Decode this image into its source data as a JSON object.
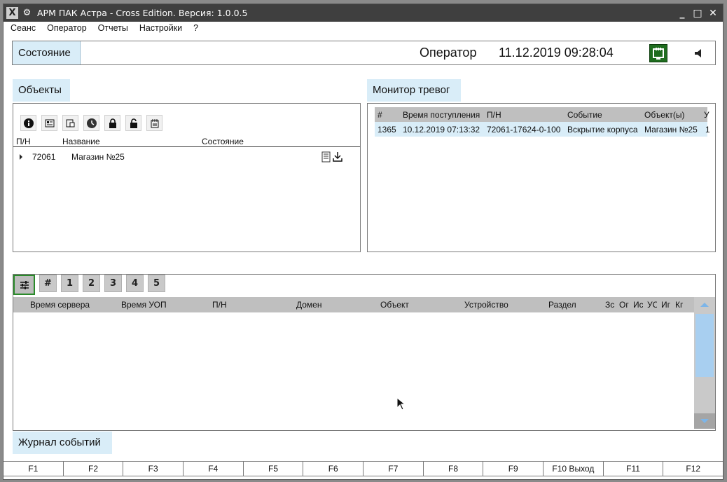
{
  "window": {
    "title": "АРМ ПАК Астра - Cross Edition. Версия: 1.0.0.5"
  },
  "menu": [
    "Сеанс",
    "Оператор",
    "Отчеты",
    "Настройки",
    "?"
  ],
  "status": {
    "label": "Состояние",
    "operator": "Оператор",
    "datetime": "11.12.2019 09:28:04",
    "network_icon": "network-connected-icon",
    "network_color": "#1f6d1f",
    "sound_icon": "speaker-icon"
  },
  "objects": {
    "tab_label": "Объекты",
    "toolbar_icons": [
      "info-icon",
      "card-icon",
      "folder-link-icon",
      "clock-icon",
      "lock-icon",
      "unlock-icon",
      "calendar-icon"
    ],
    "columns": [
      "П/Н",
      "Название",
      "Состояние"
    ],
    "rows": [
      {
        "pn": "72061",
        "name": "Магазин №25"
      }
    ]
  },
  "alarms": {
    "tab_label": "Монитор тревог",
    "columns": [
      "#",
      "Время поступления",
      "П/Н",
      "Событие",
      "Объект(ы)",
      "У"
    ],
    "rows": [
      {
        "num": "1365",
        "time": "10.12.2019 07:13:32",
        "pn": "72061-17624-0-100",
        "event": "Вскрытие корпуса",
        "object": "Магазин №25",
        "extra": "1"
      }
    ],
    "selected_color": "#d9edf8"
  },
  "journal": {
    "tab_label": "Журнал событий",
    "toolbar": [
      "filter-icon",
      "#",
      "1",
      "2",
      "3",
      "4",
      "5"
    ],
    "columns": [
      "Время сервера",
      "Время УОП",
      "П/Н",
      "Домен",
      "Объект",
      "Устройство",
      "Раздел",
      "Зс",
      "Ог",
      "Ис",
      "УС",
      "Иг",
      "Кг"
    ]
  },
  "fkeys": [
    "F1",
    "F2",
    "F3",
    "F4",
    "F5",
    "F6",
    "F7",
    "F8",
    "F9",
    "F10 Выход",
    "F11",
    "F12"
  ]
}
